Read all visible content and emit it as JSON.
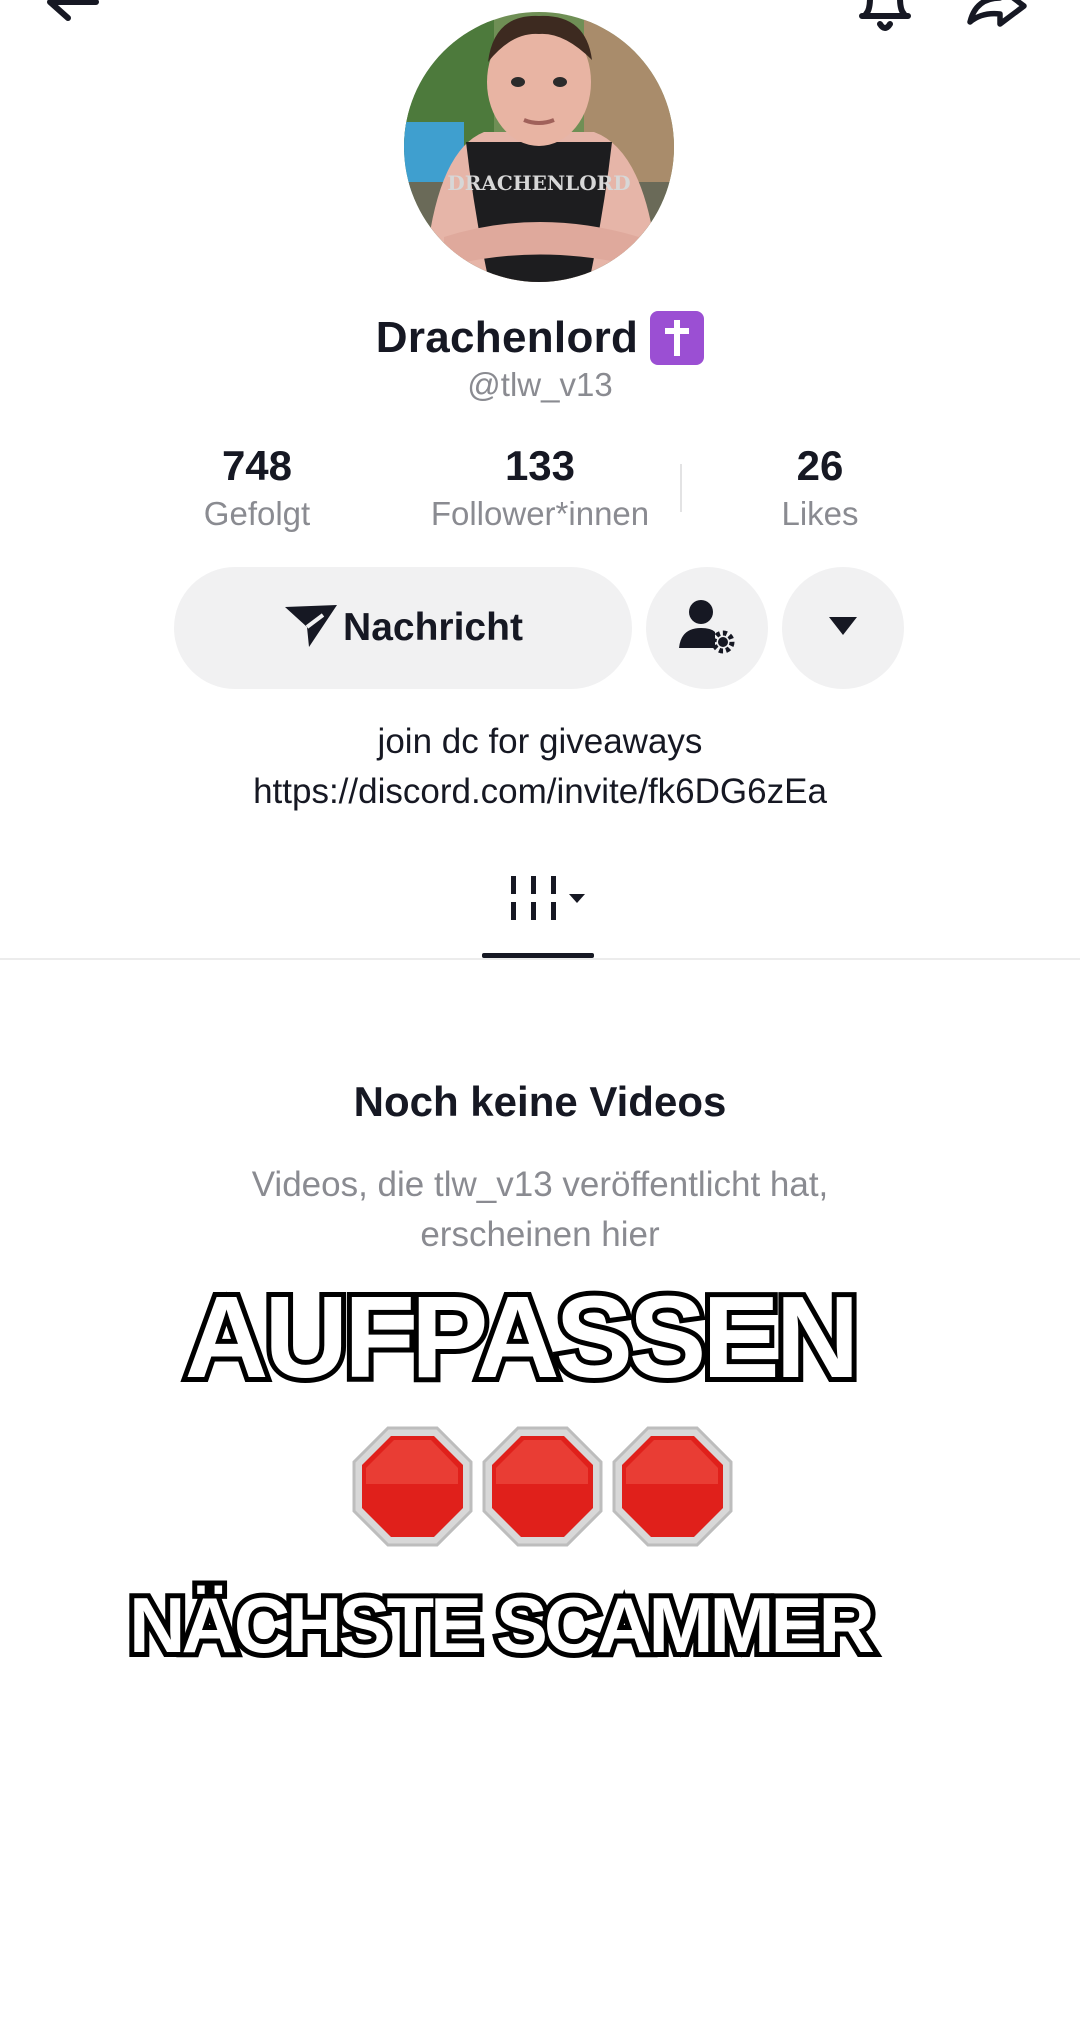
{
  "header": {
    "back_icon": "arrow-left-icon",
    "bell_icon": "bell-icon",
    "share_icon": "share-arrow-icon"
  },
  "profile": {
    "display_name": "Drachenlord",
    "badge": "✝️",
    "handle": "@tlw_v13",
    "avatar_shirt_text": "DRACHENLORD"
  },
  "stats": [
    {
      "value": "748",
      "label": "Gefolgt"
    },
    {
      "value": "133",
      "label": "Follower*innen"
    },
    {
      "value": "26",
      "label": "Likes"
    }
  ],
  "actions": {
    "message_label": "Nachricht",
    "message_icon": "send-icon",
    "follow_settings_icon": "user-gear-icon",
    "more_icon": "caret-down-icon"
  },
  "bio": {
    "line1": "join dc for giveaways",
    "line2": "https://discord.com/invite/fk6DG6zEa"
  },
  "tabs": {
    "videos_icon": "grid-bars-icon"
  },
  "empty_state": {
    "title": "Noch keine Videos",
    "subtitle_line1": "Videos, die tlw_v13 veröffentlicht hat,",
    "subtitle_line2": "erscheinen hier"
  },
  "overlay": {
    "headline": "AUFPASSEN",
    "emoji": "🛑🛑🛑",
    "footer": "NÄCHSTE SCAMMER"
  },
  "colors": {
    "text_primary": "#161823",
    "text_secondary": "#8a8b91",
    "button_bg": "#f1f1f2",
    "badge_purple": "#9b4fd3",
    "stop_red": "#e0201b"
  }
}
